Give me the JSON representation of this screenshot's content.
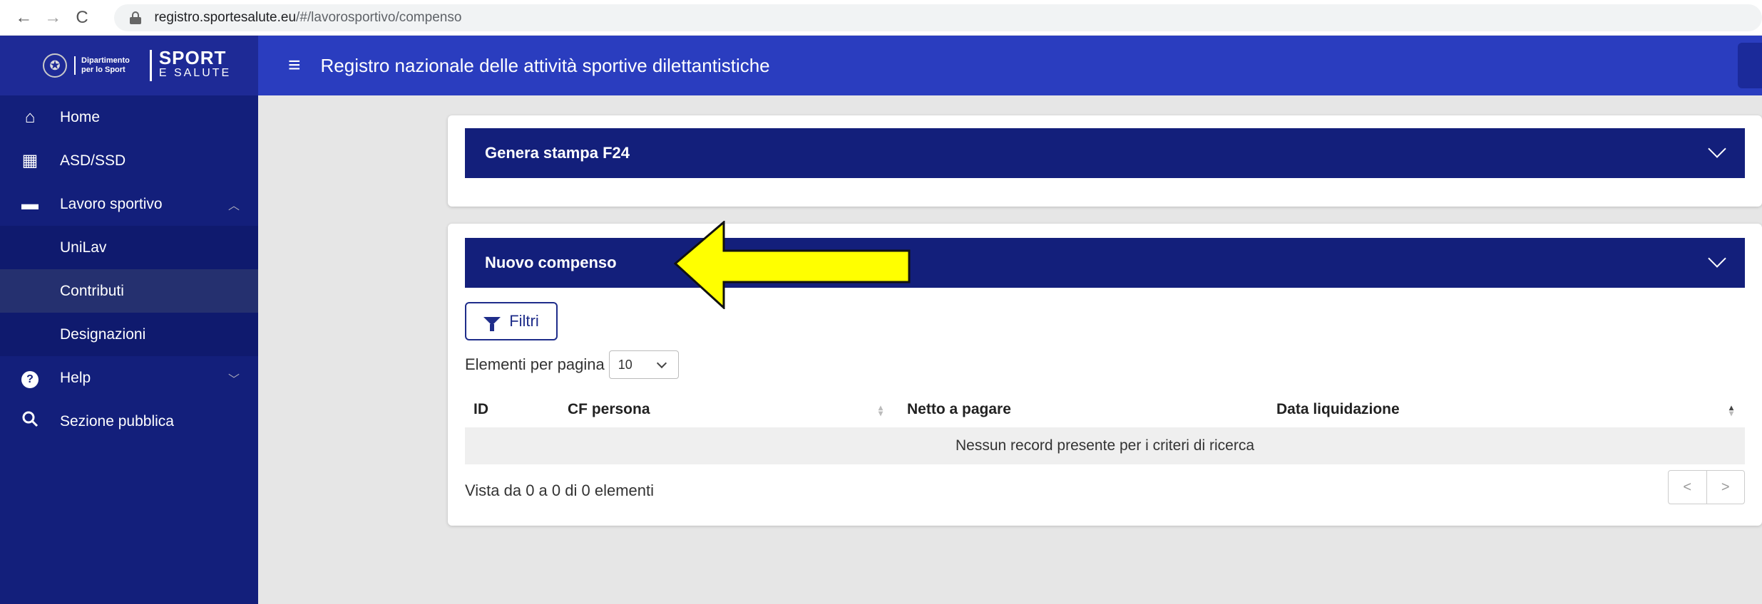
{
  "browser": {
    "back": "←",
    "forward": "→",
    "reload": "C",
    "url_host": "registro.sportesalute.eu",
    "url_path": "/#/lavorosportivo/compenso"
  },
  "sidebar": {
    "logo": {
      "dip_line1": "Dipartimento",
      "dip_line2": "per lo Sport",
      "sport": "SPORT",
      "salute": "E SALUTE"
    },
    "items": [
      {
        "label": "Home",
        "icon": "home-icon"
      },
      {
        "label": "ASD/SSD",
        "icon": "building-icon"
      },
      {
        "label": "Lavoro sportivo",
        "icon": "briefcase-icon",
        "expanded": true
      },
      {
        "label": "Help",
        "icon": "help-icon"
      },
      {
        "label": "Sezione pubblica",
        "icon": "search-icon"
      }
    ],
    "subitems": [
      {
        "label": "UniLav"
      },
      {
        "label": "Contributi",
        "active": true
      },
      {
        "label": "Designazioni"
      }
    ]
  },
  "header": {
    "title": "Registro nazionale delle attività sportive dilettantistiche"
  },
  "panels": {
    "f24": {
      "title": "Genera stampa F24"
    },
    "compenso": {
      "title": "Nuovo compenso"
    }
  },
  "filters": {
    "label": "Filtri"
  },
  "pagination": {
    "per_page_label": "Elementi per pagina",
    "per_page_value": "10",
    "info": "Vista da 0 a 0 di 0 elementi",
    "prev": "<",
    "next": ">"
  },
  "table": {
    "columns": [
      "ID",
      "CF persona",
      "Netto a pagare",
      "Data liquidazione"
    ],
    "empty_message": "Nessun record presente per i criteri di ricerca"
  },
  "colors": {
    "sidebar": "#131f7b",
    "header": "#2a3dbf",
    "panel": "#131f7b",
    "arrow": "#ffff00"
  }
}
